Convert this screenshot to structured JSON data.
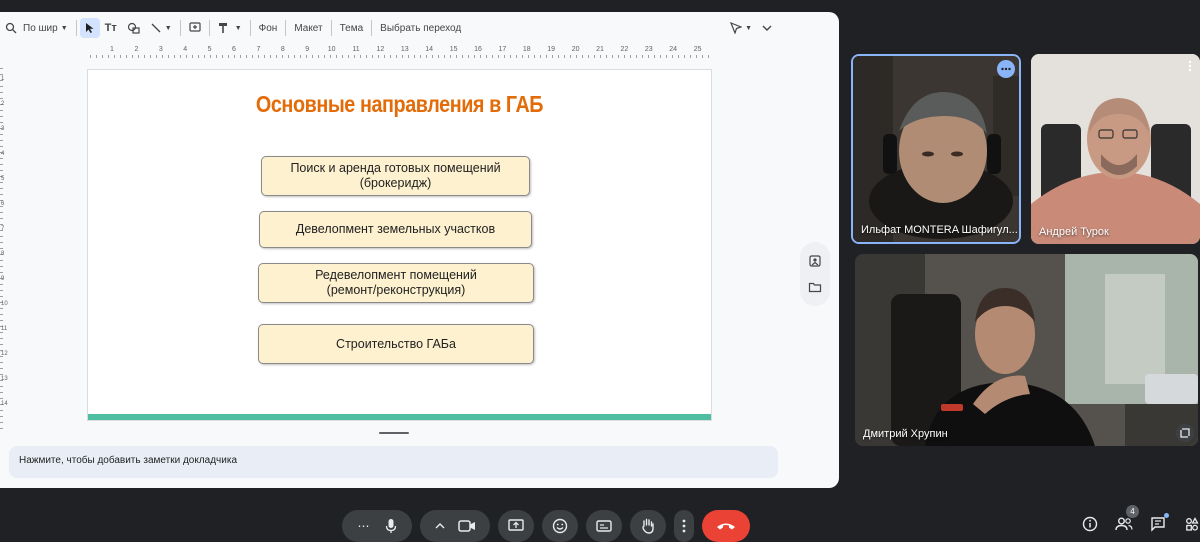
{
  "editor": {
    "toolbar": {
      "zoom_label": "По шир",
      "background_label": "Фон",
      "layout_label": "Макет",
      "theme_label": "Тема",
      "transition_label": "Выбрать переход"
    },
    "ruler_numbers": [
      "1",
      "2",
      "3",
      "4",
      "5",
      "6",
      "7",
      "8",
      "9",
      "10",
      "11",
      "12",
      "13",
      "14",
      "15",
      "16",
      "17",
      "18",
      "19",
      "20",
      "21",
      "22",
      "23",
      "24",
      "25"
    ],
    "vruler_numbers": [
      "1",
      "2",
      "3",
      "4",
      "5",
      "6",
      "7",
      "8",
      "9",
      "10",
      "11",
      "12",
      "13",
      "14"
    ],
    "notes_placeholder": "Нажмите, чтобы добавить заметки докладчика"
  },
  "slide": {
    "title": "Основные направления в ГАБ",
    "title_color": "#e36c09",
    "box_fill": "#fdf1cf",
    "bar_color": "#4dbfa0",
    "boxes": [
      {
        "text": "Поиск и аренда готовых помещений\n(брокеридж)"
      },
      {
        "text": "Девелопмент земельных участков"
      },
      {
        "text": "Редевелопмент помещений\n(ремонт/реконструкция)"
      },
      {
        "text": "Строительство ГАБа"
      }
    ]
  },
  "participants": [
    {
      "name": "Ильфат MONTERA Шафигул..."
    },
    {
      "name": "Андрей Турок"
    },
    {
      "name": "Дмитрий Хрупин"
    }
  ],
  "controls": {
    "participants_count": "4",
    "end_call_color": "#ea4335"
  }
}
